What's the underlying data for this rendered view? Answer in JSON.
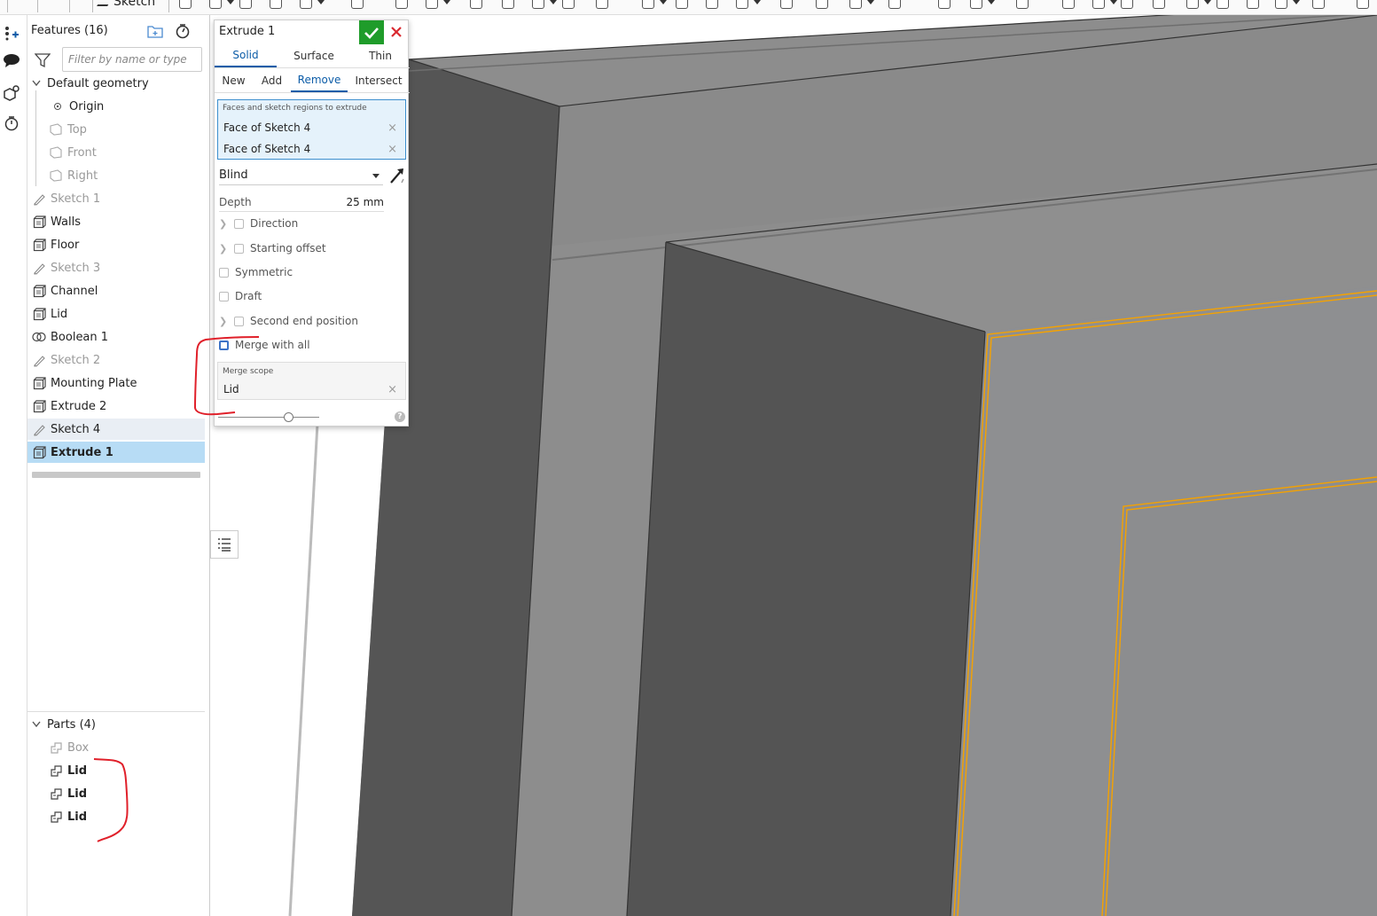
{
  "toolbar": {
    "sketch_label": "Sketch"
  },
  "tree": {
    "title": "Features (16)",
    "filter_placeholder": "Filter by name or type",
    "default_geometry": "Default geometry",
    "geometry": [
      "Origin",
      "Top",
      "Front",
      "Right"
    ],
    "features": [
      {
        "label": "Sketch 1",
        "kind": "sketch",
        "state": "dim"
      },
      {
        "label": "Walls",
        "kind": "extrude",
        "state": "normal"
      },
      {
        "label": "Floor",
        "kind": "extrude",
        "state": "normal"
      },
      {
        "label": "Sketch 3",
        "kind": "sketch",
        "state": "dim"
      },
      {
        "label": "Channel",
        "kind": "extrude",
        "state": "normal"
      },
      {
        "label": "Lid",
        "kind": "extrude",
        "state": "normal"
      },
      {
        "label": "Boolean 1",
        "kind": "boolean",
        "state": "normal"
      },
      {
        "label": "Sketch 2",
        "kind": "sketch",
        "state": "dim"
      },
      {
        "label": "Mounting Plate",
        "kind": "extrude",
        "state": "normal"
      },
      {
        "label": "Extrude 2",
        "kind": "extrude",
        "state": "normal"
      },
      {
        "label": "Sketch 4",
        "kind": "sketch",
        "state": "hover"
      },
      {
        "label": "Extrude 1",
        "kind": "extrude",
        "state": "selected"
      }
    ],
    "parts_title": "Parts (4)",
    "parts": [
      {
        "label": "Box",
        "state": "dim"
      },
      {
        "label": "Lid",
        "state": "bold"
      },
      {
        "label": "Lid",
        "state": "bold"
      },
      {
        "label": "Lid",
        "state": "bold"
      }
    ]
  },
  "dialog": {
    "title": "Extrude 1",
    "body_types": [
      "Solid",
      "Surface",
      "Thin"
    ],
    "active_body_type": "Solid",
    "operations": [
      "New",
      "Add",
      "Remove",
      "Intersect"
    ],
    "active_operation": "Remove",
    "selection_label": "Faces and sketch regions to extrude",
    "selections": [
      "Face of Sketch 4",
      "Face of Sketch 4"
    ],
    "end_type": "Blind",
    "depth_label": "Depth",
    "depth_value": "25 mm",
    "options": [
      {
        "label": "Direction",
        "expandable": true
      },
      {
        "label": "Starting offset",
        "expandable": true
      },
      {
        "label": "Symmetric",
        "expandable": false
      },
      {
        "label": "Draft",
        "expandable": false
      },
      {
        "label": "Second end position",
        "expandable": true
      },
      {
        "label": "Merge with all",
        "expandable": false
      }
    ],
    "merge_scope_label": "Merge scope",
    "merge_scope_value": "Lid",
    "help_glyph": "?"
  },
  "colors": {
    "selection_tab": "#0d5da8",
    "ok_green": "#1f9c2a",
    "cancel_red": "#d9282f",
    "tree_selected": "#b7dcf5",
    "highlight_orange": "#f5a200",
    "annotation_red": "#e0202a"
  }
}
